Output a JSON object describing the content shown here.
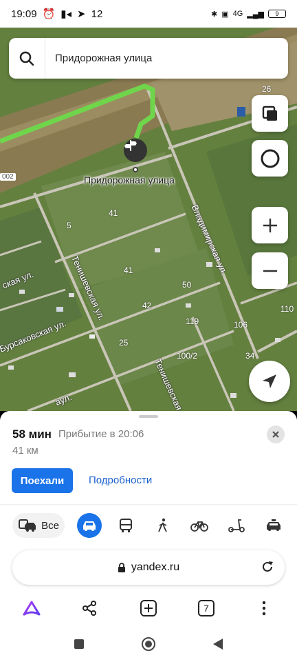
{
  "status_bar": {
    "time": "19:09",
    "notifications": "12",
    "network": "4G",
    "battery": "9"
  },
  "search": {
    "text": "Придорожная улица"
  },
  "map": {
    "place_label": "Придорожная улица",
    "road_badge": "002",
    "house_numbers": [
      "26",
      "41",
      "5",
      "41",
      "50",
      "42",
      "119",
      "25",
      "106",
      "100/2",
      "34",
      "110"
    ],
    "streets": {
      "vladimirskaya": "Владимирская ул.",
      "tenishevskaya_1": "Тенишевская ул.",
      "tenishevskaya_2": "Тенишевская",
      "bursakovskaya": "Бурсаковская ул.",
      "kskaya": "ская ул.",
      "aul": "аул."
    }
  },
  "route": {
    "duration": "58 мин",
    "arrival": "Прибытие в 20:06",
    "distance": "41 км",
    "go_label": "Поехали",
    "details_label": "Подробности"
  },
  "modes": {
    "all_label": "Все"
  },
  "browser": {
    "url": "yandex.ru",
    "tab_count": "7"
  },
  "colors": {
    "accent": "#1a73e8",
    "route": "#6fd64b"
  }
}
